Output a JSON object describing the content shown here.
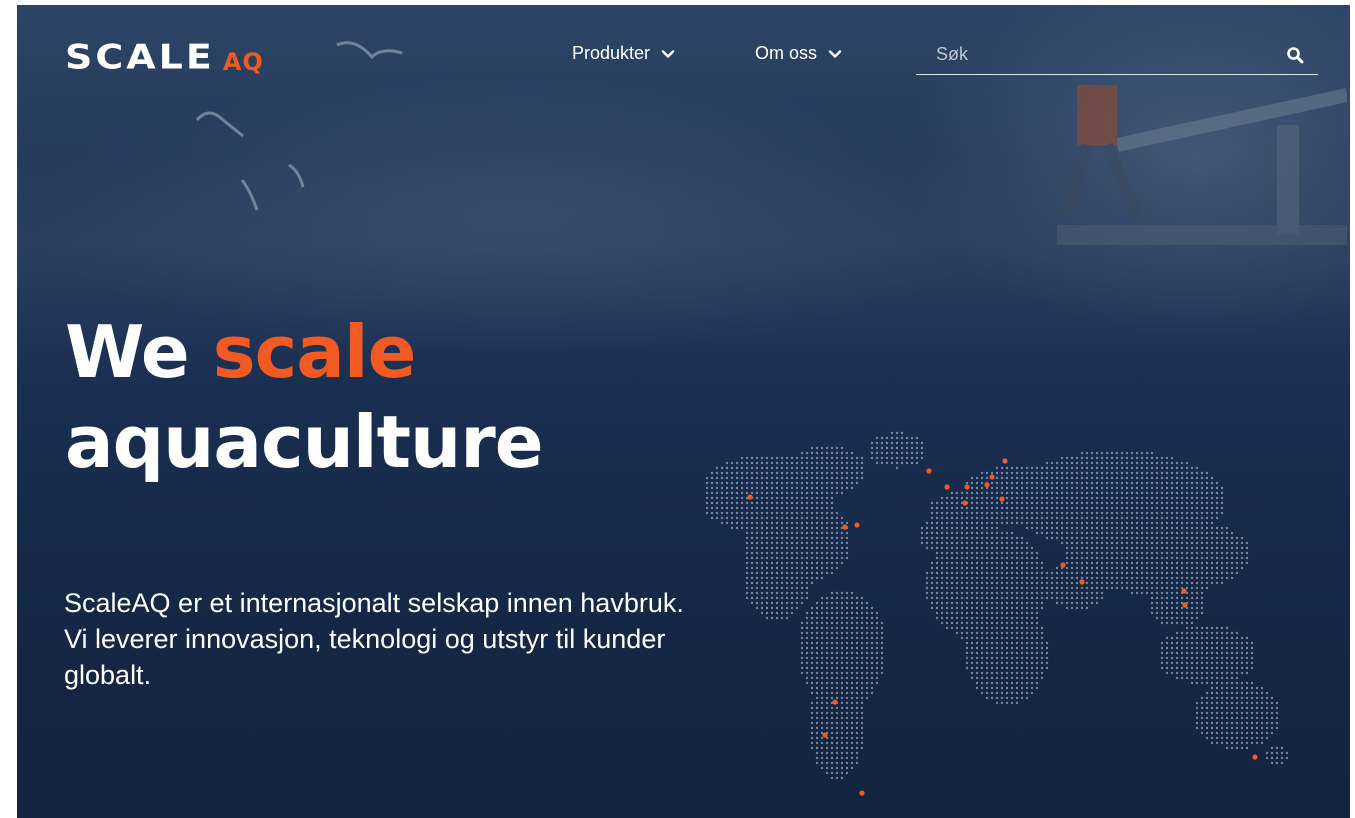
{
  "brand": {
    "logo_main": "SCALE",
    "logo_accent": "AQ",
    "accent_color": "#f15a22"
  },
  "nav": {
    "items": [
      {
        "label": "Produkter",
        "icon": "chevron-down-icon"
      },
      {
        "label": "Om oss",
        "icon": "chevron-down-icon"
      }
    ]
  },
  "search": {
    "placeholder": "Søk",
    "value": "",
    "icon": "search-icon"
  },
  "hero": {
    "headline_word1": "We",
    "headline_accent": "scale",
    "headline_line2": "aquaculture",
    "lead": "ScaleAQ er et internasjonalt selskap innen havbruk. Vi leverer innovasjon, teknologi og utstyr til kunder globalt."
  },
  "colors": {
    "background": "#17294a",
    "text": "#ffffff",
    "accent": "#f15a22"
  }
}
